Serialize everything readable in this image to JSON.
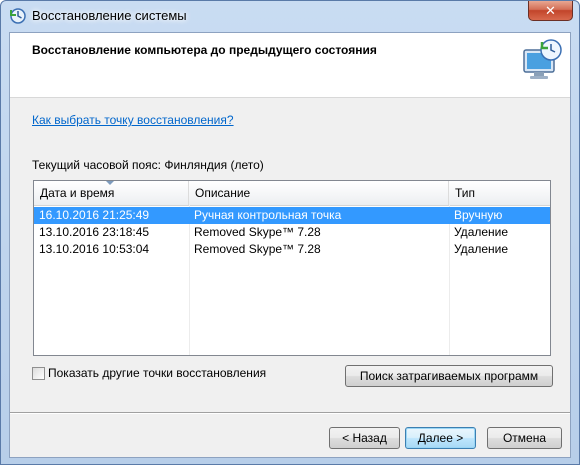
{
  "window": {
    "title": "Восстановление системы",
    "close_label": "✕"
  },
  "header": {
    "title": "Восстановление компьютера до предыдущего состояния"
  },
  "help_link": "Как выбрать точку восстановления?",
  "timezone_label": "Текущий часовой пояс: Финляндия (лето)",
  "table": {
    "columns": [
      "Дата и время",
      "Описание",
      "Тип"
    ],
    "sorted_column": 0,
    "rows": [
      {
        "date": "16.10.2016 21:25:49",
        "description": "Ручная контрольная точка",
        "type": "Вручную",
        "selected": true
      },
      {
        "date": "13.10.2016 23:18:45",
        "description": "Removed Skype™ 7.28",
        "type": "Удаление",
        "selected": false
      },
      {
        "date": "13.10.2016 10:53:04",
        "description": "Removed Skype™ 7.28",
        "type": "Удаление",
        "selected": false
      }
    ]
  },
  "show_more": {
    "label": "Показать другие точки восстановления",
    "checked": false
  },
  "buttons": {
    "scan": "Поиск затрагиваемых программ",
    "back": "< Назад",
    "next": "Далее >",
    "cancel": "Отмена"
  },
  "colors": {
    "selection": "#3399ff",
    "link": "#0066cc",
    "close_button": "#c2442a"
  },
  "icons": {
    "title": "system-restore-icon",
    "header": "system-restore-monitor-icon",
    "sort": "sort-descending-arrow"
  }
}
